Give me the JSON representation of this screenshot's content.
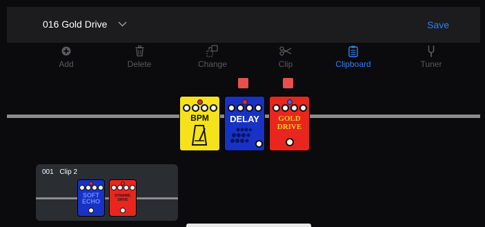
{
  "header": {
    "preset_name": "016 Gold Drive",
    "save_label": "Save"
  },
  "toolbar": {
    "tools": [
      {
        "label": "Add",
        "icon": "add-icon",
        "active": false
      },
      {
        "label": "Delete",
        "icon": "trash-icon",
        "active": false
      },
      {
        "label": "Change",
        "icon": "change-icon",
        "active": false
      },
      {
        "label": "Clip",
        "icon": "scissors-icon",
        "active": false
      },
      {
        "label": "Clipboard",
        "icon": "clipboard-icon",
        "active": true
      },
      {
        "label": "Tuner",
        "icon": "tuner-fork-icon",
        "active": false
      }
    ]
  },
  "chain": {
    "pedals": [
      {
        "name": "BPM",
        "color": "#f6e21a",
        "text_color": "#111111"
      },
      {
        "name": "DELAY",
        "color": "#1732c4",
        "text_color": "#ffffff"
      },
      {
        "name_line1": "GOLD",
        "name_line2": "DRIVE",
        "color": "#e8261e",
        "text_color": "#f6d321"
      }
    ]
  },
  "clip": {
    "number": "001",
    "name": "Clip 2",
    "pedals": [
      {
        "name_line1": "SOFT",
        "name_line2": "ECHO",
        "color": "#1732c4",
        "text_color": "#6f8dff"
      },
      {
        "name_line1": "DYNAMIC",
        "name_line2": "DRIVE",
        "color": "#e8261e",
        "text_color": "#1a1a1a"
      }
    ]
  },
  "colors": {
    "accent": "#2f7ff6",
    "marker": "#e8504b",
    "header_bg": "#1c1c1e"
  }
}
